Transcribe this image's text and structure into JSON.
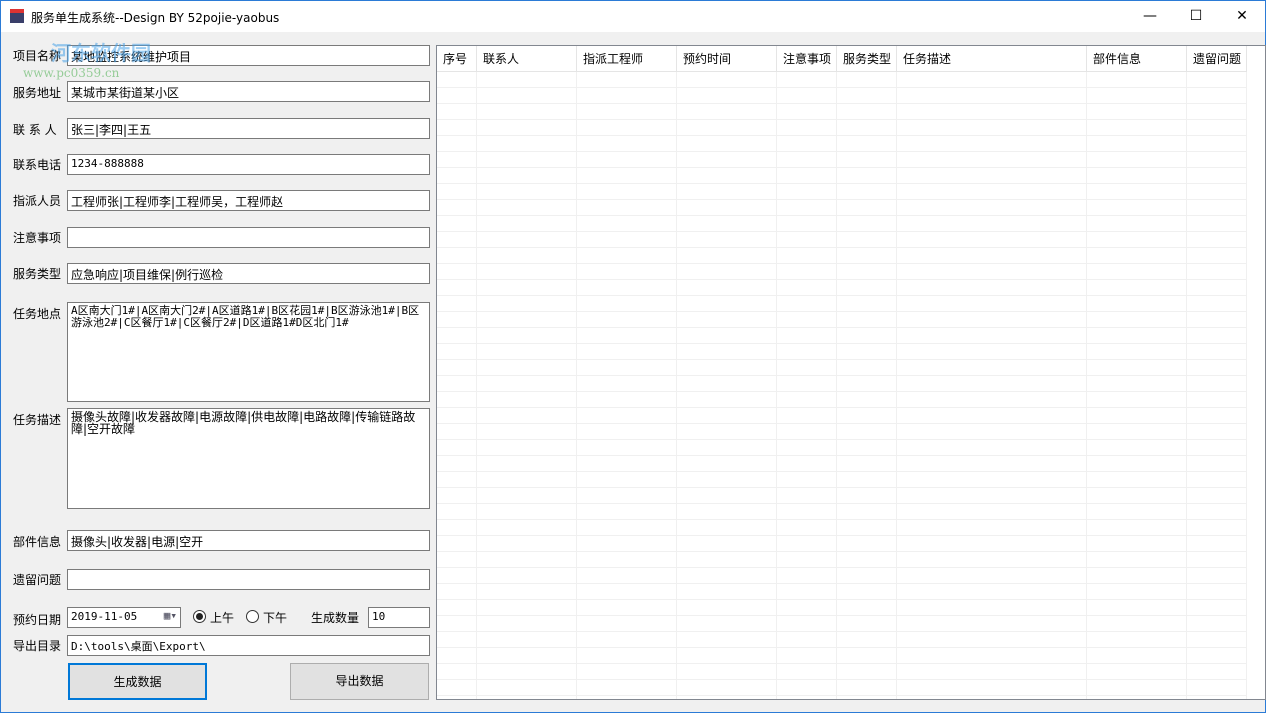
{
  "window": {
    "title": "服务单生成系统--Design BY 52pojie-yaobus",
    "minimize": "—",
    "maximize": "☐",
    "close": "✕"
  },
  "watermark": {
    "logo_text": "河东软件园",
    "url": "www.pc0359.cn"
  },
  "form": {
    "project_name": {
      "label": "项目名称",
      "value": "某地监控系统维护项目"
    },
    "service_address": {
      "label": "服务地址",
      "value": "某城市某街道某小区"
    },
    "contact": {
      "label": "联 系 人",
      "value": "张三|李四|王五"
    },
    "phone": {
      "label": "联系电话",
      "value": "1234-888888"
    },
    "assignee": {
      "label": "指派人员",
      "value": "工程师张|工程师李|工程师吴，工程师赵"
    },
    "notes": {
      "label": "注意事项",
      "value": ""
    },
    "service_type": {
      "label": "服务类型",
      "value": "应急响应|项目维保|例行巡检"
    },
    "task_location": {
      "label": "任务地点",
      "value": "A区南大门1#|A区南大门2#|A区道路1#|B区花园1#|B区游泳池1#|B区游泳池2#|C区餐厅1#|C区餐厅2#|D区道路1#D区北门1#"
    },
    "task_desc": {
      "label": "任务描述",
      "value": "摄像头故障|收发器故障|电源故障|供电故障|电路故障|传输链路故障|空开故障"
    },
    "parts": {
      "label": "部件信息",
      "value": "摄像头|收发器|电源|空开"
    },
    "issues": {
      "label": "遗留问题",
      "value": ""
    },
    "date": {
      "label": "预约日期",
      "value": "2019-11-05"
    },
    "am": {
      "label": "上午",
      "checked": true
    },
    "pm": {
      "label": "下午",
      "checked": false
    },
    "count": {
      "label": "生成数量",
      "value": "10"
    },
    "export_dir": {
      "label": "导出目录",
      "value": "D:\\tools\\桌面\\Export\\"
    },
    "generate_button": "生成数据",
    "export_button": "导出数据"
  },
  "table": {
    "columns": [
      "序号",
      "联系人",
      "指派工程师",
      "预约时间",
      "注意事项",
      "服务类型",
      "任务描述",
      "部件信息",
      "遗留问题"
    ],
    "rows": []
  }
}
